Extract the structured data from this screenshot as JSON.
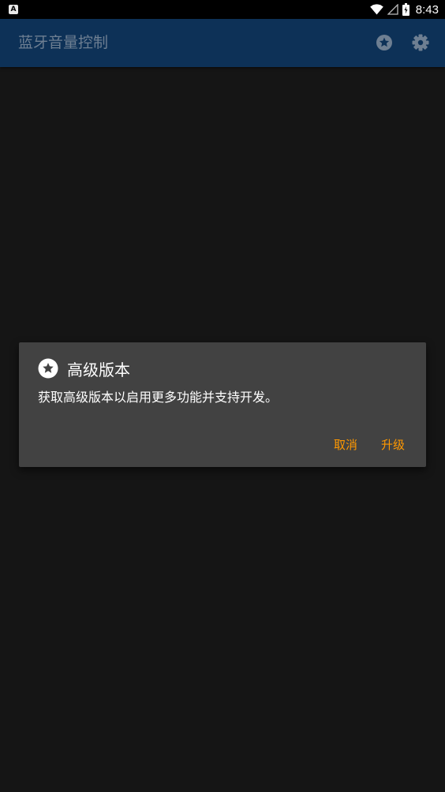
{
  "status_bar": {
    "app_icon_letter": "A",
    "time": "8:43",
    "icons": [
      "wifi-icon",
      "signal-icon",
      "battery-icon"
    ]
  },
  "app_bar": {
    "title": "蓝牙音量控制",
    "actions": [
      "star-icon",
      "gear-icon"
    ],
    "background_color": "#0d3157"
  },
  "dialog": {
    "icon": "star-icon",
    "title": "高级版本",
    "message": "获取高级版本以启用更多功能并支持开发。",
    "cancel_label": "取消",
    "upgrade_label": "升级",
    "accent_color": "#ff9800"
  }
}
